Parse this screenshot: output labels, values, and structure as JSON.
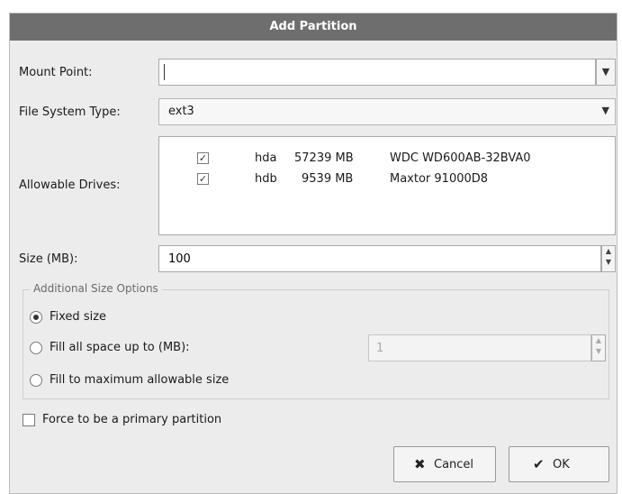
{
  "dialog": {
    "title": "Add Partition"
  },
  "mount_point": {
    "label": "Mount Point:",
    "value": "",
    "dropdown_icon": "chevron-down-icon"
  },
  "file_system": {
    "label": "File System Type:",
    "value": "ext3",
    "dropdown_icon": "chevron-down-icon"
  },
  "drives": {
    "label": "Allowable Drives:",
    "rows": [
      {
        "checked": true,
        "device": "hda",
        "size": "57239 MB",
        "model": "WDC WD600AB-32BVA0"
      },
      {
        "checked": true,
        "device": "hdb",
        "size": "9539 MB",
        "model": "Maxtor 91000D8"
      }
    ]
  },
  "size": {
    "label": "Size (MB):",
    "value": "100"
  },
  "additional_options": {
    "title": "Additional Size Options",
    "options": [
      {
        "label": "Fixed size",
        "selected": true
      },
      {
        "label": "Fill all space up to (MB):",
        "selected": false
      },
      {
        "label": "Fill to maximum allowable size",
        "selected": false
      }
    ],
    "fill_up_to_value": "1"
  },
  "primary": {
    "label": "Force to be a primary partition",
    "checked": false
  },
  "buttons": {
    "cancel_label": "Cancel",
    "cancel_icon": "x-icon",
    "ok_label": "OK",
    "ok_icon": "ok-icon"
  },
  "colors": {
    "titlebar": "#6e6e6e",
    "dialog_bg": "#ececec"
  }
}
